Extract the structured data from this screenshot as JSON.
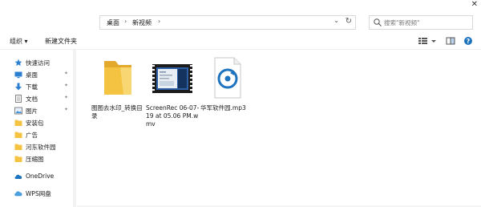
{
  "window": {
    "close_glyph": "✕"
  },
  "address": {
    "crumbs": [
      "桌面",
      "新视频"
    ],
    "separator": "›",
    "dropdown_glyph": "⌄",
    "refresh_glyph": "↻"
  },
  "search": {
    "placeholder": "搜索\"新视频\""
  },
  "toolbar": {
    "organize_label": "组织 ▾",
    "new_folder_label": "新建文件夹",
    "help_glyph": "?"
  },
  "nav": {
    "items": [
      {
        "label": "快速访问",
        "icon": "star-icon",
        "pinned": false
      },
      {
        "label": "桌面",
        "icon": "desktop-icon",
        "pinned": true
      },
      {
        "label": "下载",
        "icon": "download-icon",
        "pinned": true
      },
      {
        "label": "文档",
        "icon": "document-icon",
        "pinned": true
      },
      {
        "label": "图片",
        "icon": "picture-icon",
        "pinned": true
      },
      {
        "label": "安装包",
        "icon": "folder-icon",
        "pinned": false
      },
      {
        "label": "广告",
        "icon": "folder-icon",
        "pinned": false
      },
      {
        "label": "河东软件园",
        "icon": "folder-icon",
        "pinned": false
      },
      {
        "label": "压缩图",
        "icon": "folder-icon",
        "pinned": false
      },
      {
        "label": "OneDrive",
        "icon": "cloud-icon",
        "pinned": false
      },
      {
        "label": "WPS网盘",
        "icon": "cloud-icon",
        "pinned": false
      }
    ],
    "pin_glyph": "✦"
  },
  "files": [
    {
      "name": "图图去水印_转换目录",
      "type": "folder"
    },
    {
      "name": "ScreenRec 06-07-19 at 05.06 PM.wmv",
      "type": "video"
    },
    {
      "name": "华军软件园.mp3",
      "type": "audio"
    }
  ],
  "colors": {
    "folder": "#f5c342",
    "folder_dark": "#e3a92c",
    "accent": "#1e73be"
  }
}
